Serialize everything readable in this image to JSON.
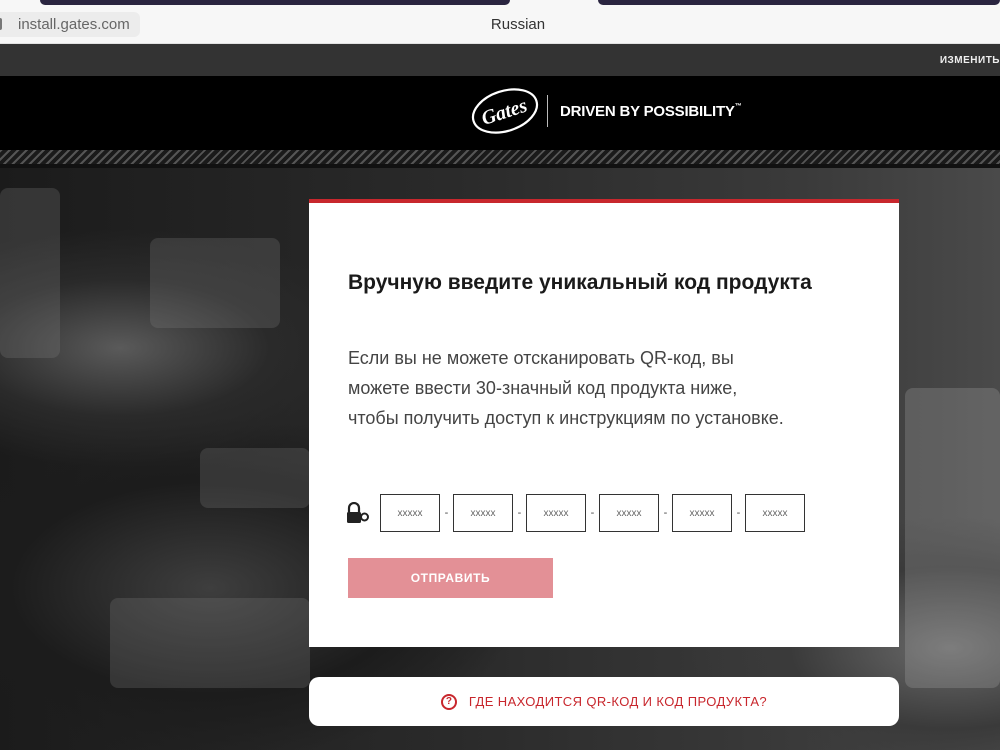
{
  "browser": {
    "url": "install.gates.com",
    "translate_language": "Russian"
  },
  "topbar": {
    "change_link": "ИЗМЕНИТЬ"
  },
  "header": {
    "logo_text": "Gates",
    "tagline": "DRIVEN BY POSSIBILITY",
    "tagline_mark": "™"
  },
  "card": {
    "title": "Вручную введите уникальный код продукта",
    "description": "Если вы не можете отсканировать QR-код, вы можете ввести 30-значный код продукта ниже, чтобы получить доступ к инструкциям по установке.",
    "code_placeholders": [
      "xxxxx",
      "xxxxx",
      "xxxxx",
      "xxxxx",
      "xxxxx",
      "xxxxx"
    ],
    "separator": "-",
    "submit_label": "ОТПРАВИТЬ",
    "lock_icon": "lock-key-icon"
  },
  "help": {
    "icon": "question-circle-icon",
    "icon_glyph": "?",
    "text": "ГДЕ НАХОДИТСЯ QR-КОД И КОД ПРОДУКТА?"
  },
  "colors": {
    "accent_red": "#c8272d",
    "button_disabled": "#e39096",
    "header_bg": "#000000"
  }
}
